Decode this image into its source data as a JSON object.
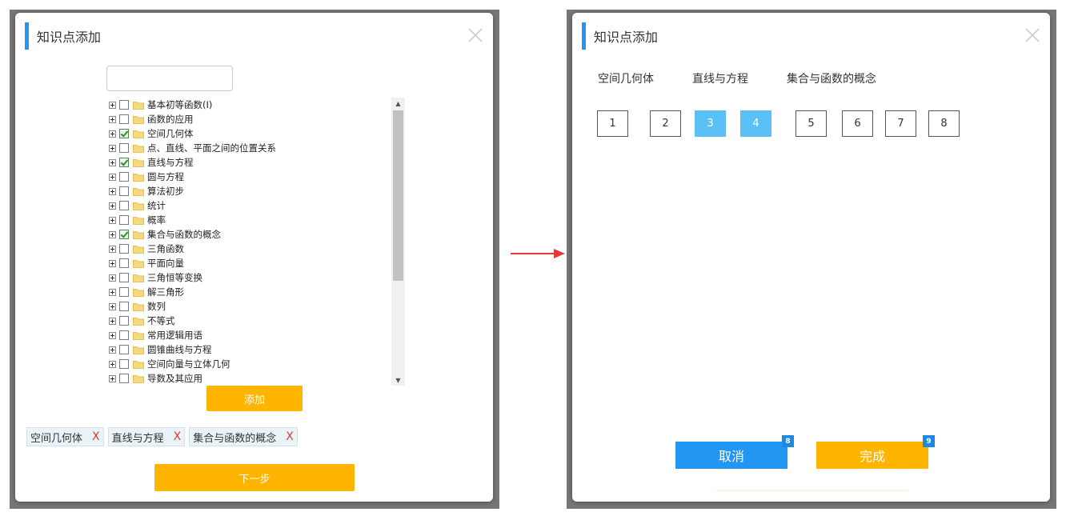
{
  "left_dialog": {
    "title": "知识点添加",
    "search": {
      "value": "",
      "placeholder": ""
    },
    "tree_items": [
      {
        "label": "基本初等函数(Ⅰ)",
        "checked": false
      },
      {
        "label": "函数的应用",
        "checked": false
      },
      {
        "label": "空间几何体",
        "checked": true
      },
      {
        "label": "点、直线、平面之间的位置关系",
        "checked": false
      },
      {
        "label": "直线与方程",
        "checked": true
      },
      {
        "label": "圆与方程",
        "checked": false
      },
      {
        "label": "算法初步",
        "checked": false
      },
      {
        "label": "统计",
        "checked": false
      },
      {
        "label": "概率",
        "checked": false
      },
      {
        "label": "集合与函数的概念",
        "checked": true
      },
      {
        "label": "三角函数",
        "checked": false
      },
      {
        "label": "平面向量",
        "checked": false
      },
      {
        "label": "三角恒等变换",
        "checked": false
      },
      {
        "label": "解三角形",
        "checked": false
      },
      {
        "label": "数列",
        "checked": false
      },
      {
        "label": "不等式",
        "checked": false
      },
      {
        "label": "常用逻辑用语",
        "checked": false
      },
      {
        "label": "圆锥曲线与方程",
        "checked": false
      },
      {
        "label": "空间向量与立体几何",
        "checked": false
      },
      {
        "label": "导数及其应用",
        "checked": false
      }
    ],
    "add_button": "添加",
    "selected_tags": [
      {
        "label": "空间几何体",
        "remove": "X"
      },
      {
        "label": "直线与方程",
        "remove": "X"
      },
      {
        "label": "集合与函数的概念",
        "remove": "X"
      }
    ],
    "next_button": "下一步"
  },
  "right_dialog": {
    "title": "知识点添加",
    "categories": [
      "空间几何体",
      "直线与方程",
      "集合与函数的概念"
    ],
    "numbers": [
      {
        "label": "1",
        "selected": false
      },
      {
        "label": "2",
        "selected": false
      },
      {
        "label": "3",
        "selected": true
      },
      {
        "label": "4",
        "selected": true
      },
      {
        "label": "5",
        "selected": false
      },
      {
        "label": "6",
        "selected": false
      },
      {
        "label": "7",
        "selected": false
      },
      {
        "label": "8",
        "selected": false
      }
    ],
    "cancel_button": "取消",
    "cancel_badge": "8",
    "done_button": "完成",
    "done_badge": "9"
  },
  "colors": {
    "accent_blue": "#2196f3",
    "action_orange": "#ffb400",
    "selected_cell": "#5bc0f5",
    "arrow_red": "#e53935"
  }
}
